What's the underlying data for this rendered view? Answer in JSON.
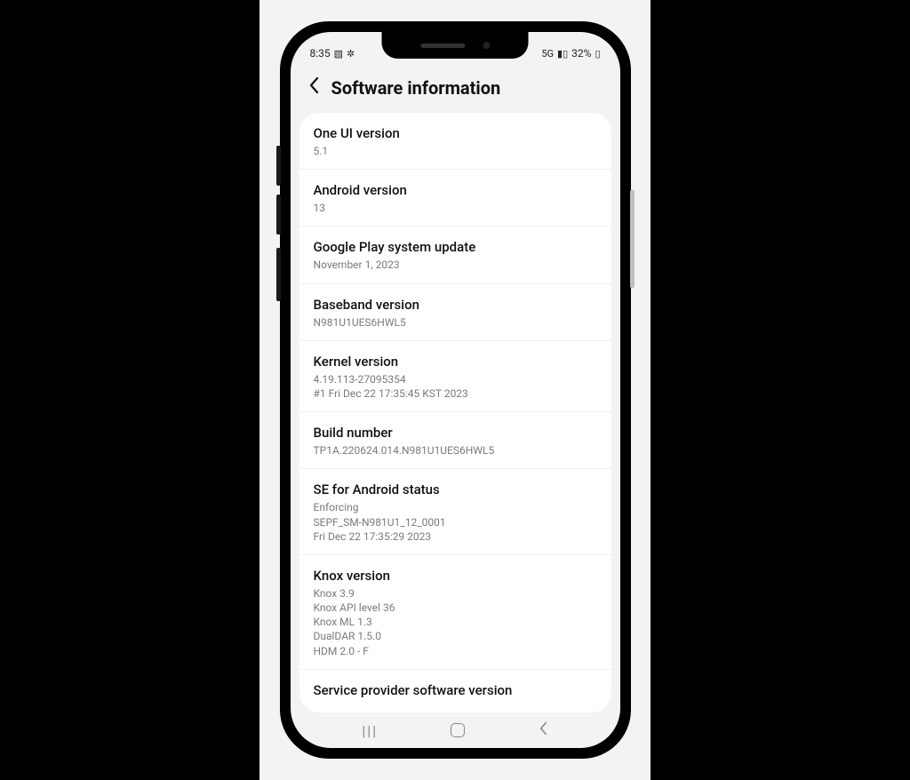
{
  "status": {
    "time": "8:35",
    "battery": "32%"
  },
  "header": {
    "title": "Software information"
  },
  "rows": [
    {
      "label": "One UI version",
      "value": "5.1"
    },
    {
      "label": "Android version",
      "value": "13"
    },
    {
      "label": "Google Play system update",
      "value": "November 1, 2023"
    },
    {
      "label": "Baseband version",
      "value": "N981U1UES6HWL5"
    },
    {
      "label": "Kernel version",
      "value": "4.19.113-27095354\n#1 Fri Dec 22 17:35:45 KST 2023"
    },
    {
      "label": "Build number",
      "value": "TP1A.220624.014.N981U1UES6HWL5"
    },
    {
      "label": "SE for Android status",
      "value": "Enforcing\nSEPF_SM-N981U1_12_0001\nFri Dec 22 17:35:29 2023"
    },
    {
      "label": "Knox version",
      "value": "Knox 3.9\nKnox API level 36\nKnox ML 1.3\nDualDAR 1.5.0\nHDM 2.0 - F"
    },
    {
      "label": "Service provider software version",
      "value": ""
    }
  ]
}
